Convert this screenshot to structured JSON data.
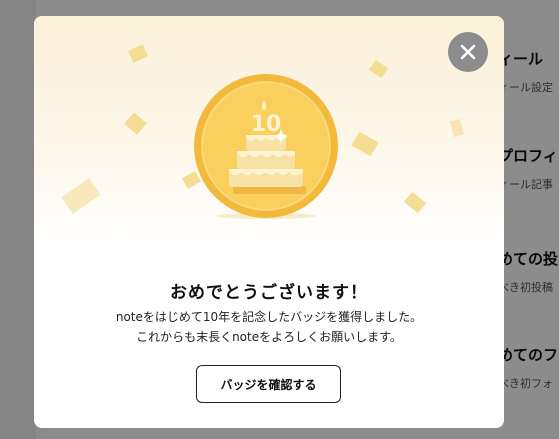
{
  "background_page": {
    "items": [
      {
        "title": "ィール",
        "subtitle": "ィール設定"
      },
      {
        "title": "プロフィ",
        "subtitle": "ィール記事"
      },
      {
        "title": "めての投",
        "subtitle": "べき初投稿"
      },
      {
        "title": "めてのフ",
        "subtitle": "べき初フォ"
      }
    ]
  },
  "modal": {
    "badge_number": "10",
    "title": "おめでとうございます！",
    "message_line1": "noteをはじめて10年を記念したバッジを獲得しました。",
    "message_line2": "これからも末長くnoteをよろしくお願いします。",
    "confirm_label": "バッジを確認する",
    "close_icon": "close-icon"
  },
  "colors": {
    "badge_gold": "#f6c54b",
    "confetti": "#f3d98a",
    "overlay": "rgba(0,0,0,0.45)"
  }
}
